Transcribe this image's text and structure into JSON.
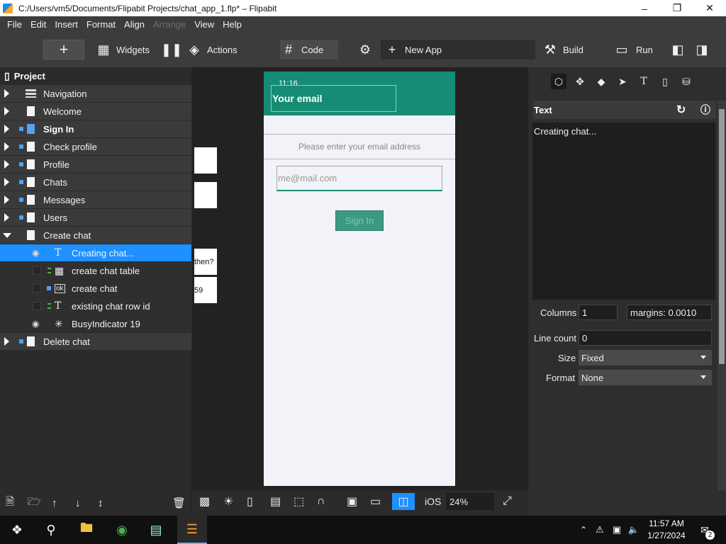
{
  "window": {
    "title": "C:/Users/vm5/Documents/Flipabit Projects/chat_app_1.flp* – Flipabit",
    "minimize": "–",
    "maximize": "❐",
    "close": "✕"
  },
  "menu": [
    "File",
    "Edit",
    "Insert",
    "Format",
    "Align",
    "Arrange",
    "View",
    "Help"
  ],
  "toolbar": {
    "add": "+",
    "widgets": "Widgets",
    "actions": "Actions",
    "code": "Code",
    "new_app": "New App",
    "build": "Build",
    "run": "Run"
  },
  "project": {
    "title": "Project",
    "pages": [
      {
        "label": "Navigation"
      },
      {
        "label": "Welcome"
      },
      {
        "label": "Sign In"
      },
      {
        "label": "Check profile"
      },
      {
        "label": "Profile"
      },
      {
        "label": "Chats"
      },
      {
        "label": "Messages"
      },
      {
        "label": "Users"
      },
      {
        "label": "Create chat"
      }
    ],
    "children": [
      {
        "label": "Creating chat..."
      },
      {
        "label": "create chat table"
      },
      {
        "label": "create chat"
      },
      {
        "label": "existing chat row id"
      },
      {
        "label": "BusyIndicator 19"
      }
    ],
    "last": {
      "label": "Delete chat"
    }
  },
  "canvas": {
    "side_labels": [
      "then?",
      "59"
    ],
    "phone": {
      "time": "11:16",
      "email_title": "Your email",
      "instruction": "Please enter your email address",
      "input_placeholder": "me@mail.com",
      "button": "Sign In"
    },
    "bottom": {
      "platform": "iOS",
      "zoom": "24%"
    }
  },
  "inspector": {
    "section": "Text",
    "text_value": "Creating chat...",
    "columns_label": "Columns",
    "columns_value": "1",
    "margins": "margins: 0.0010",
    "line_count_label": "Line count",
    "line_count_value": "0",
    "size_label": "Size",
    "size_value": "Fixed",
    "format_label": "Format",
    "format_value": "None"
  },
  "taskbar": {
    "time": "11:57 AM",
    "date": "1/27/2024",
    "notifications": "2"
  },
  "colors": {
    "selection": "#1e90ff",
    "phone_header": "#168c74",
    "panel_bg": "#2b2b2b"
  }
}
